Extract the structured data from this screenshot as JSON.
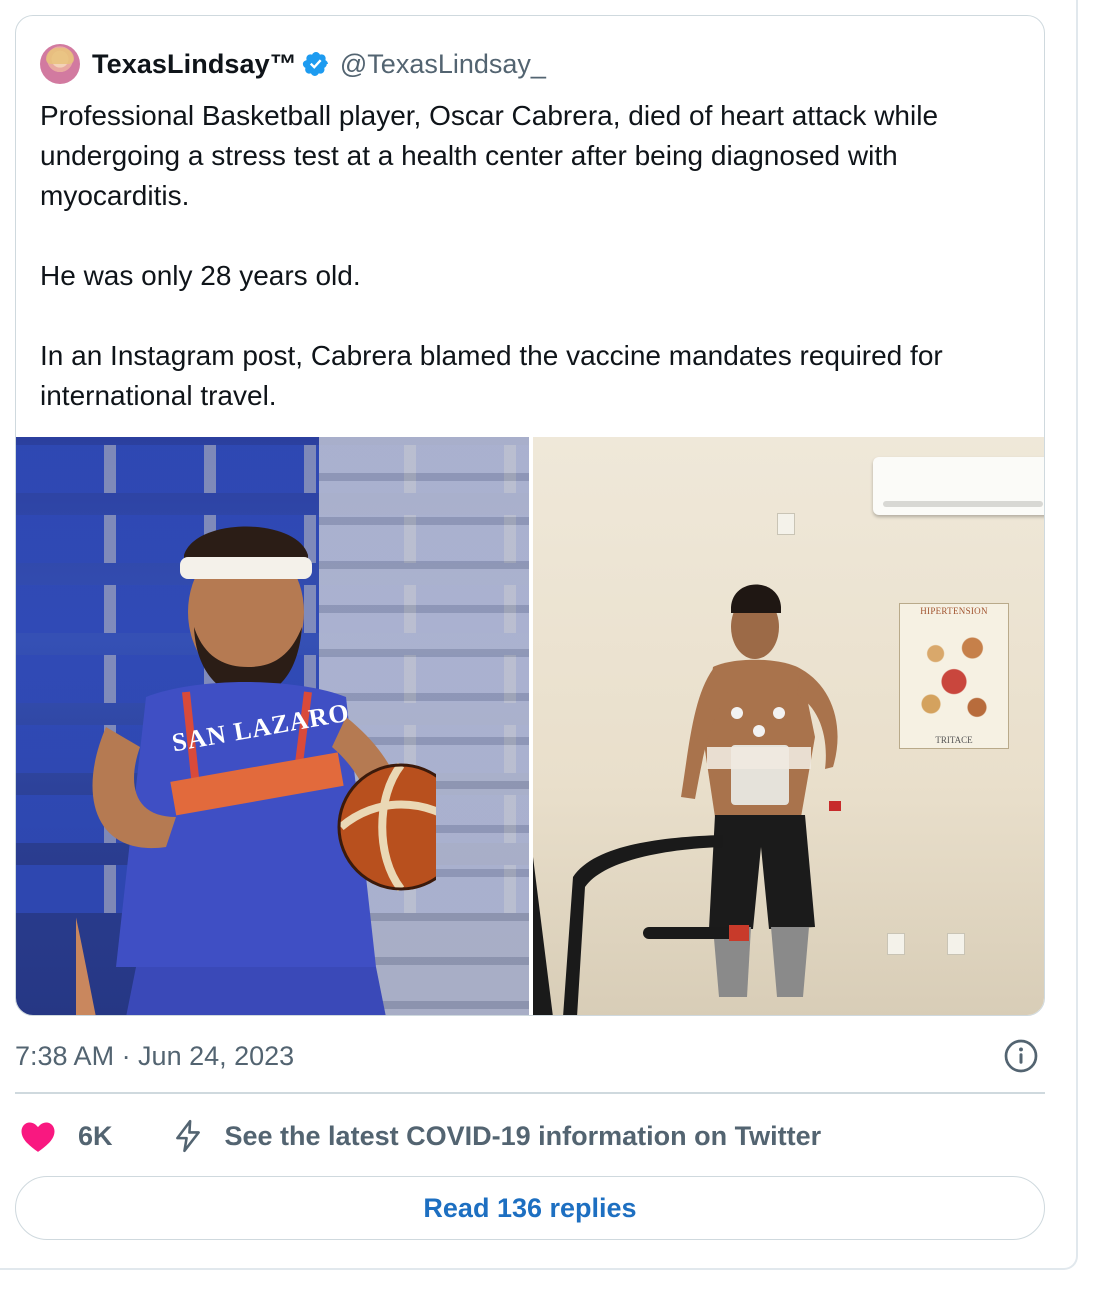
{
  "tweet": {
    "display_name": "TexasLindsay™",
    "handle": "@TexasLindsay_",
    "paragraphs": [
      "Professional Basketball player, Oscar Cabrera, died of heart attack while undergoing a stress test at a health center after being diagnosed with myocarditis.",
      "He was only 28 years old.",
      "In an Instagram post, Cabrera blamed the vaccine mandates required for international travel."
    ],
    "timestamp": "7:38 AM · Jun 24, 2023",
    "likes": "6K",
    "covid_info": "See the latest COVID-19 information on Twitter",
    "replies_button": "Read 136 replies"
  },
  "media": {
    "photo_left": {
      "jersey_text": "SAN LAZARO"
    },
    "photo_right": {
      "poster_title": "HIPERTENSION",
      "poster_brand": "TRITACE"
    }
  },
  "icons": {
    "verified": "verified-badge-icon",
    "info": "info-icon",
    "heart": "heart-icon",
    "bolt": "lightning-bolt-icon"
  },
  "colors": {
    "verified": "#1d9bf0",
    "heart": "#f91880",
    "link": "#1d6fc1",
    "secondary_text": "#536471",
    "border": "#cfd9de"
  }
}
